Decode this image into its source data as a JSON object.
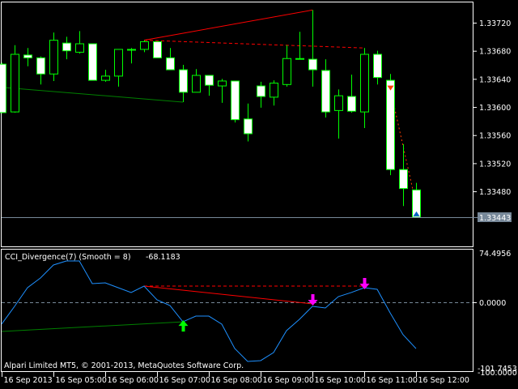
{
  "colors": {
    "bull_border": "#00ff00",
    "bear_fill": "#ffffff",
    "bg": "#000000",
    "cci": "#1e90ff",
    "bid_line": "#778899",
    "div_red": "#ff0000",
    "div_green": "#008000",
    "arrow_up": "#00ff00",
    "arrow_down": "#ff00ff",
    "signal_down": "#ff4000",
    "signal_up": "#0060c0"
  },
  "price_axis": {
    "ticks": [
      "1.33720",
      "1.33680",
      "1.33640",
      "1.33600",
      "1.33560",
      "1.33520",
      "1.33480"
    ],
    "tick_values": [
      1.3372,
      1.3368,
      1.3364,
      1.336,
      1.3356,
      1.3352,
      1.3348
    ],
    "range": [
      1.33415,
      1.33752
    ],
    "current_price": "1.33443",
    "current_value": 1.33443
  },
  "indicator": {
    "title": "CCI_Divergence(7) (Smooth = 8)",
    "value": "-68.1183",
    "max_label": "74.4956",
    "zero_label": "0.0000",
    "min_label": "-101.7453",
    "min2_label": "-100.0000",
    "range": [
      -101.7453,
      74.4956
    ]
  },
  "copyright": "Alpari Limited MT5, © 2001-2013, MetaQuotes Software Corp.",
  "time_axis": {
    "labels": [
      "16 Sep 2013",
      "16 Sep 05:00",
      "16 Sep 06:00",
      "16 Sep 07:00",
      "16 Sep 08:00",
      "16 Sep 09:00",
      "16 Sep 10:00",
      "16 Sep 11:00",
      "16 Sep 12:00"
    ],
    "bar_index": [
      0,
      4,
      8,
      12,
      16,
      20,
      24,
      28,
      32
    ]
  },
  "chart_data": {
    "type": "candlestick",
    "candles": [
      [
        1.33661,
        1.33663,
        1.33591,
        1.33592
      ],
      [
        1.33593,
        1.33688,
        1.33592,
        1.33675
      ],
      [
        1.33674,
        1.33684,
        1.33658,
        1.3367
      ],
      [
        1.3367,
        1.33672,
        1.33632,
        1.33647
      ],
      [
        1.33647,
        1.33706,
        1.33637,
        1.33695
      ],
      [
        1.33691,
        1.337,
        1.33668,
        1.3368
      ],
      [
        1.33678,
        1.33708,
        1.33676,
        1.3369
      ],
      [
        1.3369,
        1.3369,
        1.33638,
        1.33638
      ],
      [
        1.33638,
        1.33653,
        1.33636,
        1.33644
      ],
      [
        1.33644,
        1.33682,
        1.33629,
        1.33682
      ],
      [
        1.33682,
        1.33684,
        1.33662,
        1.33681
      ],
      [
        1.33682,
        1.33695,
        1.33678,
        1.33693
      ],
      [
        1.33693,
        1.33693,
        1.3367,
        1.3367
      ],
      [
        1.3367,
        1.33684,
        1.33653,
        1.33653
      ],
      [
        1.33653,
        1.3366,
        1.33607,
        1.33621
      ],
      [
        1.33621,
        1.33654,
        1.33621,
        1.33645
      ],
      [
        1.33645,
        1.33645,
        1.33616,
        1.33631
      ],
      [
        1.3363,
        1.3364,
        1.33606,
        1.33637
      ],
      [
        1.33637,
        1.33637,
        1.33578,
        1.33582
      ],
      [
        1.33583,
        1.33605,
        1.33551,
        1.33562
      ],
      [
        1.3363,
        1.33636,
        1.33599,
        1.33615
      ],
      [
        1.33614,
        1.33638,
        1.33602,
        1.33634
      ],
      [
        1.33632,
        1.33688,
        1.33629,
        1.33669
      ],
      [
        1.33669,
        1.33707,
        1.33668,
        1.33668
      ],
      [
        1.33668,
        1.33738,
        1.33629,
        1.33653
      ],
      [
        1.33652,
        1.33668,
        1.33585,
        1.33593
      ],
      [
        1.33595,
        1.33625,
        1.33555,
        1.33616
      ],
      [
        1.33615,
        1.33646,
        1.33592,
        1.33594
      ],
      [
        1.33593,
        1.33684,
        1.3357,
        1.33675
      ],
      [
        1.33675,
        1.3368,
        1.33632,
        1.33642
      ],
      [
        1.33638,
        1.33647,
        1.33503,
        1.33511
      ],
      [
        1.33511,
        1.33547,
        1.33459,
        1.33484
      ],
      [
        1.33482,
        1.33492,
        1.33443,
        1.33443
      ]
    ],
    "cci": [
      -31.7,
      -5.2,
      22.6,
      37.1,
      56.4,
      62.4,
      62.4,
      28.6,
      29.8,
      22.6,
      15.4,
      25.0,
      4.5,
      -4.0,
      -28.2,
      -19.7,
      -19.7,
      -31.7,
      -67.9,
      -87.3,
      -86.0,
      -74.0,
      -41.4,
      -24.5,
      -5.2,
      -7.6,
      9.3,
      15.4,
      22.6,
      20.2,
      -14.8,
      -47.4,
      -68.1
    ],
    "price_lines": [
      {
        "type": "solid",
        "color": "red",
        "from": [
          11,
          1.33695
        ],
        "to": [
          24,
          1.33738
        ]
      },
      {
        "type": "dashed",
        "color": "red",
        "from": [
          11,
          1.33695
        ],
        "to": [
          28,
          1.33684
        ]
      },
      {
        "type": "solid",
        "color": "green",
        "from": [
          0,
          1.33628
        ],
        "to": [
          14,
          1.33607
        ]
      },
      {
        "type": "dotted",
        "color": "orange",
        "from": [
          30,
          1.33627
        ],
        "to": [
          32,
          1.33462
        ]
      }
    ],
    "cci_lines": [
      {
        "type": "solid",
        "color": "red",
        "from": [
          11,
          25.0
        ],
        "to": [
          24,
          -1.5
        ]
      },
      {
        "type": "dashed",
        "color": "red",
        "from": [
          11,
          25.0
        ],
        "to": [
          28,
          25.0
        ]
      },
      {
        "type": "solid",
        "color": "green",
        "from": [
          0,
          -42.6
        ],
        "to": [
          14,
          -28.2
        ]
      }
    ],
    "cci_arrows": [
      {
        "bar": 14,
        "dir": "up",
        "value": -28.2
      },
      {
        "bar": 24,
        "dir": "down",
        "value": -1.5
      },
      {
        "bar": 28,
        "dir": "down",
        "value": 22.6
      }
    ],
    "price_arrows": [
      {
        "bar": 30,
        "dir": "down",
        "value": 1.33627
      },
      {
        "bar": 32,
        "dir": "up",
        "value": 1.33448
      }
    ]
  }
}
